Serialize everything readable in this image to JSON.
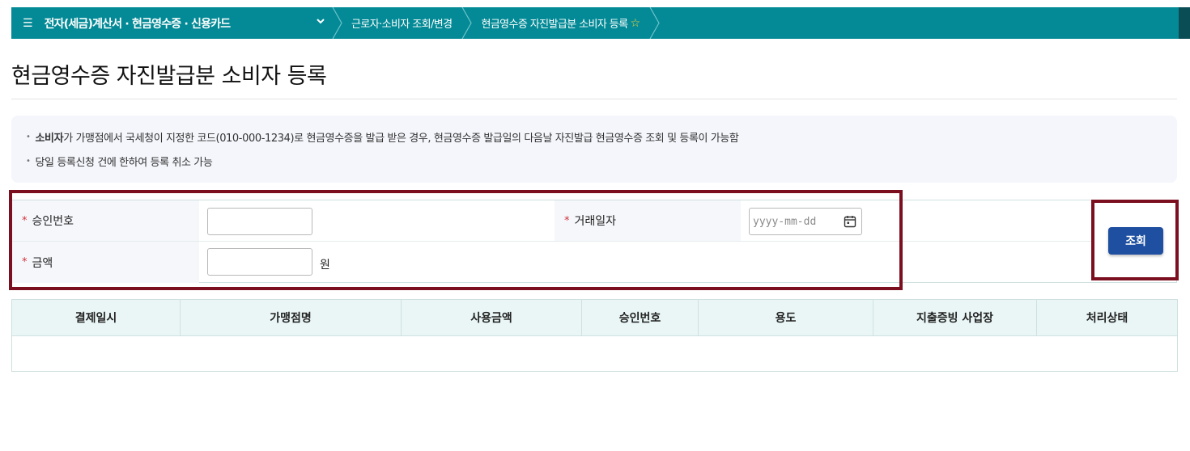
{
  "breadcrumb": {
    "menu_label": "전자(세금)계산서 · 현금영수증 · 신용카드",
    "items": [
      "근로자·소비자 조회/변경",
      "현금영수증 자진발급분 소비자 등록"
    ]
  },
  "page_title": "현금영수증 자진발급분 소비자 등록",
  "notice": {
    "line1_bold": "소비자",
    "line1_rest": "가 가맹점에서 국세청이 지정한 코드(010-000-1234)로 현금영수증을 발급 받은 경우, 현금영수증 발급일의 다음날 자진발급 현금영수증 조회 및 등록이 가능함",
    "line2": "당일 등록신청 건에 한하여 등록 취소 가능"
  },
  "form": {
    "approval_label": "승인번호",
    "approval_value": "",
    "date_label": "거래일자",
    "date_placeholder": "yyyy-mm-dd",
    "amount_label": "금액",
    "amount_value": "",
    "amount_unit": "원",
    "required_mark": "*"
  },
  "search_button": "조회",
  "table": {
    "columns": [
      "결제일시",
      "가맹점명",
      "사용금액",
      "승인번호",
      "용도",
      "지출증빙 사업장",
      "처리상태"
    ],
    "rows": []
  },
  "colors": {
    "header_bar": "#038a96",
    "primary_button": "#1e4fa0",
    "highlight_frame": "#7c0f1f",
    "required": "#d0303a"
  }
}
